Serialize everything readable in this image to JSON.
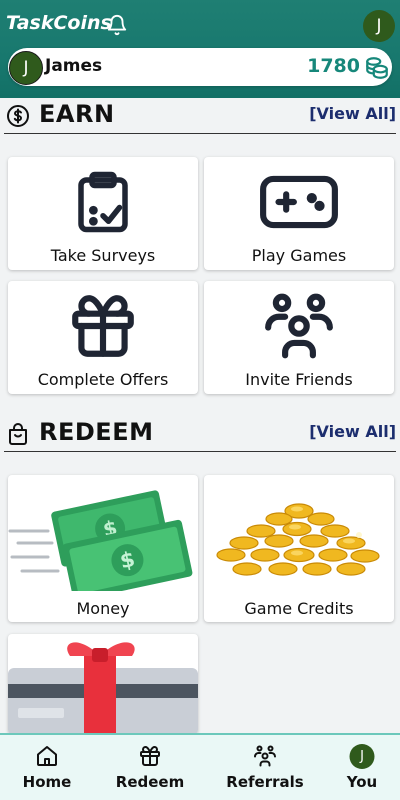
{
  "header": {
    "app_title": "TaskCoins",
    "avatar_initial": "J"
  },
  "user": {
    "avatar_initial": "J",
    "name": "James",
    "coins": "1780"
  },
  "earn": {
    "title": "EARN",
    "view_all": "[View All]",
    "cards": [
      {
        "label": "Take Surveys",
        "icon": "clipboard-check-icon"
      },
      {
        "label": "Play Games",
        "icon": "gamepad-icon"
      },
      {
        "label": "Complete Offers",
        "icon": "gift-icon"
      },
      {
        "label": "Invite Friends",
        "icon": "users-icon"
      }
    ]
  },
  "redeem": {
    "title": "REDEEM",
    "view_all": "[View All]",
    "cards": [
      {
        "label": "Money",
        "image": "cash-bills-image"
      },
      {
        "label": "Game Credits",
        "image": "gold-coins-image"
      },
      {
        "label": "",
        "image": "gift-card-image"
      }
    ]
  },
  "nav": {
    "items": [
      {
        "label": "Home",
        "icon": "home-icon"
      },
      {
        "label": "Redeem",
        "icon": "gift-icon"
      },
      {
        "label": "Referrals",
        "icon": "users-icon"
      },
      {
        "label": "You",
        "avatar_initial": "J"
      }
    ]
  },
  "colors": {
    "header": "#18786e",
    "accent": "#16877a",
    "link": "#1c2d6e",
    "avatar": "#2f5a1c",
    "nav_bg": "#eaf8f6"
  }
}
